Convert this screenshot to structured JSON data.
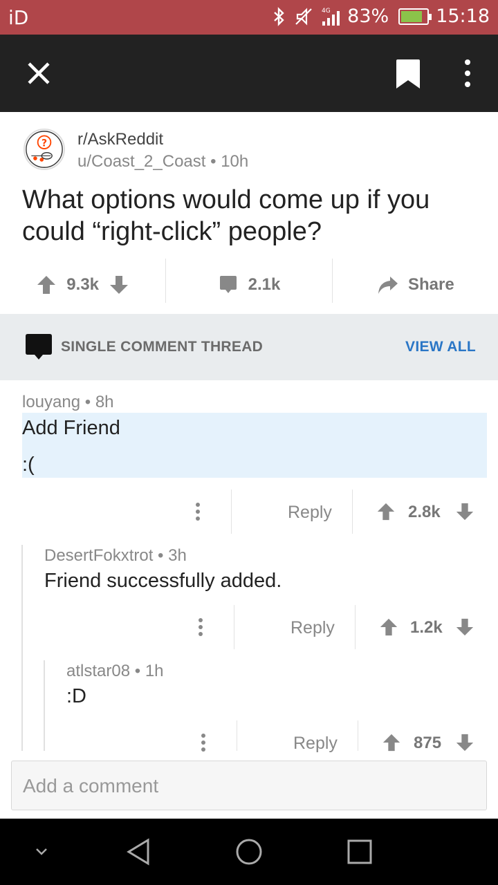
{
  "status_bar": {
    "carrier": "iD",
    "network": "4G",
    "battery_percent": "83%",
    "battery_level": 0.83,
    "time": "15:18",
    "battery_color": "#8bc34a",
    "background": "#b0464a"
  },
  "top_bar": {
    "close_icon": "close-icon",
    "bookmark_icon": "bookmark-icon",
    "more_icon": "more-vertical-icon"
  },
  "post": {
    "subreddit": "r/AskReddit",
    "author": "u/Coast_2_Coast",
    "age": "10h",
    "title": "What options would come up if you could “right-click” people?",
    "upvotes": "9.3k",
    "comments": "2.1k",
    "share_label": "Share"
  },
  "thread_bar": {
    "label": "SINGLE COMMENT THREAD",
    "view_all": "VIEW ALL",
    "accent": "#2a76c6"
  },
  "comments": [
    {
      "author": "louyang",
      "age": "8h",
      "lines": [
        "Add Friend",
        ":("
      ],
      "reply": "Reply",
      "score": "2.8k"
    },
    {
      "author": "DesertFokxtrot",
      "age": "3h",
      "lines": [
        "Friend successfully added."
      ],
      "reply": "Reply",
      "score": "1.2k"
    },
    {
      "author": "atlstar08",
      "age": "1h",
      "lines": [
        ":D"
      ],
      "reply": "Reply",
      "score": "875"
    }
  ],
  "composer": {
    "placeholder": "Add a comment"
  },
  "nav_bar": {
    "icons": [
      "chevron-down-icon",
      "back-icon",
      "home-icon",
      "recents-icon"
    ]
  }
}
